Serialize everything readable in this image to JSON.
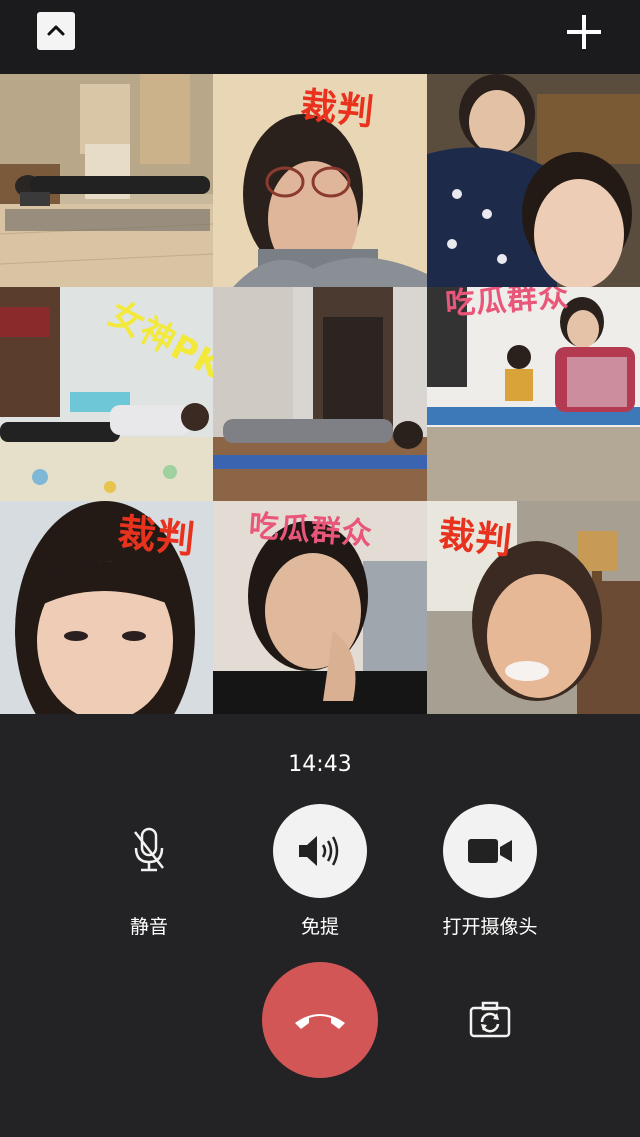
{
  "header": {
    "collapse_icon": "chevron-up-icon",
    "add_icon": "plus-icon"
  },
  "participants": [
    {
      "tag": "",
      "tag_color": ""
    },
    {
      "tag": "裁判",
      "tag_color": "#e8321e"
    },
    {
      "tag": "",
      "tag_color": ""
    },
    {
      "tag": "女神PK",
      "tag_color": "#f3e93a"
    },
    {
      "tag": "",
      "tag_color": ""
    },
    {
      "tag": "吃瓜群众",
      "tag_color": "#e8567a"
    },
    {
      "tag": "裁判",
      "tag_color": "#e8321e"
    },
    {
      "tag": "吃瓜群众",
      "tag_color": "#e8567a"
    },
    {
      "tag": "裁判",
      "tag_color": "#e8321e"
    }
  ],
  "call": {
    "timer": "14:43",
    "mute_label": "静音",
    "speaker_label": "免提",
    "camera_label": "打开摄像头",
    "mute_icon": "microphone-off-icon",
    "speaker_icon": "speaker-icon",
    "camera_icon": "video-camera-icon",
    "hangup_icon": "hang-up-icon",
    "switch_camera_icon": "switch-camera-icon"
  },
  "colors": {
    "hangup": "#d25655",
    "control_circle": "#f2f2f2",
    "background": "#232325"
  }
}
